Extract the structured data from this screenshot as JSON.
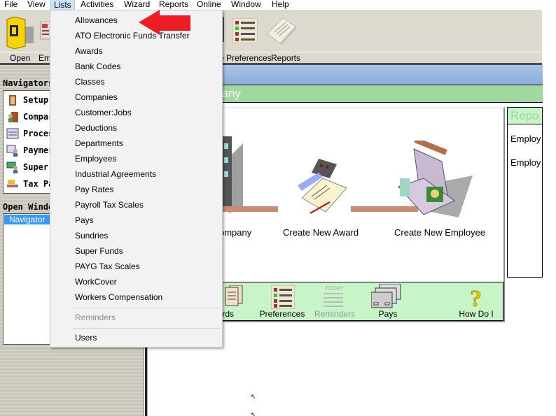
{
  "menubar": {
    "items": [
      {
        "label": "File",
        "active": false
      },
      {
        "label": "View",
        "active": false
      },
      {
        "label": "Lists",
        "active": true
      },
      {
        "label": "Activities",
        "active": false
      },
      {
        "label": "Wizard",
        "active": false
      },
      {
        "label": "Reports",
        "active": false
      },
      {
        "label": "Online",
        "active": false
      },
      {
        "label": "Window",
        "active": false
      },
      {
        "label": "Help",
        "active": false
      }
    ]
  },
  "toolbar": {
    "labels": [
      "Open",
      "Em",
      "e Preferences",
      "Reports"
    ]
  },
  "left_pane": {
    "navigators_header": "Navigators",
    "navigators": [
      {
        "label": "Setup C",
        "icon": "door-icon"
      },
      {
        "label": "Compar",
        "icon": "person-door-icon"
      },
      {
        "label": "Process",
        "icon": "form-icon"
      },
      {
        "label": "Paymer",
        "icon": "payment-person-icon"
      },
      {
        "label": "Super F",
        "icon": "money-person-icon"
      },
      {
        "label": "Tax Pay",
        "icon": "tax-hand-icon"
      }
    ],
    "open_windows_header": "Open Windo",
    "open_windows": [
      {
        "label": "Navigator",
        "selected": true
      }
    ]
  },
  "main": {
    "section_title": "pany",
    "flow_items": [
      {
        "label": "ompany"
      },
      {
        "label": "Create New Award"
      },
      {
        "label": "Create New Employee"
      }
    ],
    "reports": {
      "title": "Repo",
      "items": [
        "Employ",
        "Employ"
      ]
    },
    "bottom_bar": [
      {
        "label": "wards",
        "disabled": false
      },
      {
        "label": "Preferences",
        "disabled": false
      },
      {
        "label": "Reminders",
        "disabled": true
      },
      {
        "label": "Pays",
        "disabled": false
      },
      {
        "label": "How Do I",
        "disabled": false
      }
    ]
  },
  "lists_menu": {
    "items": [
      {
        "label": "Allowances",
        "disabled": false
      },
      {
        "label": "ATO Electronic Funds Transfer",
        "disabled": false
      },
      {
        "label": "Awards",
        "disabled": false
      },
      {
        "label": "Bank Codes",
        "disabled": false
      },
      {
        "label": "Classes",
        "disabled": false
      },
      {
        "label": "Companies",
        "disabled": false
      },
      {
        "label": "Customer:Jobs",
        "disabled": false
      },
      {
        "label": "Deductions",
        "disabled": false
      },
      {
        "label": "Departments",
        "disabled": false
      },
      {
        "label": "Employees",
        "disabled": false
      },
      {
        "label": "Industrial Agreements",
        "disabled": false
      },
      {
        "label": "Pay Rates",
        "disabled": false
      },
      {
        "label": "Payroll Tax Scales",
        "disabled": false
      },
      {
        "label": "Pays",
        "disabled": false
      },
      {
        "label": "Sundries",
        "disabled": false
      },
      {
        "label": "Super Funds",
        "disabled": false
      },
      {
        "label": "PAYG Tax Scales",
        "disabled": false
      },
      {
        "label": "WorkCover",
        "disabled": false
      },
      {
        "label": "Workers Compensation",
        "disabled": false
      },
      {
        "label": "Reminders",
        "disabled": true
      },
      {
        "label": "Users",
        "disabled": false
      }
    ]
  },
  "colors": {
    "annotation_arrow": "#ee1c24",
    "menu_bg": "#f2f2f2",
    "selection": "#3399ff",
    "green_band": "#a0d8a0",
    "light_green": "#c8f5c8"
  }
}
